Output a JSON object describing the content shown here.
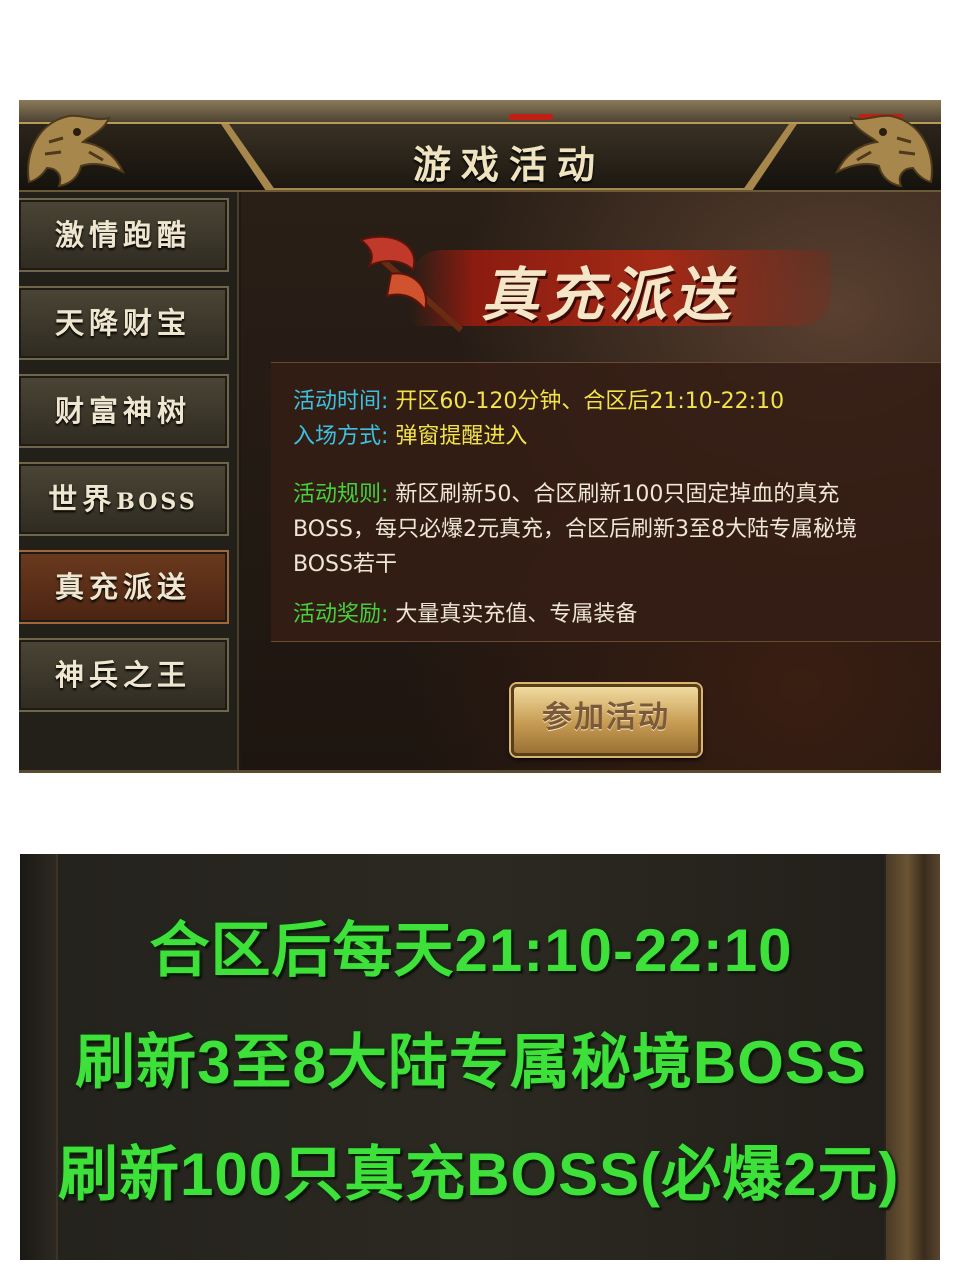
{
  "window": {
    "title": "游戏活动"
  },
  "sidebar": {
    "items": [
      {
        "label": "激情跑酷",
        "active": false
      },
      {
        "label": "天降财宝",
        "active": false
      },
      {
        "label": "财富神树",
        "active": false
      },
      {
        "label": "世界",
        "suffix": "BOSS",
        "active": false
      },
      {
        "label": "真充派送",
        "active": true
      },
      {
        "label": "神兵之王",
        "active": false
      }
    ]
  },
  "event": {
    "banner_title": "真充派送",
    "time_label": "活动时间:",
    "time_value": "开区60-120分钟、合区后21:10-22:10",
    "entry_label": "入场方式:",
    "entry_value": "弹窗提醒进入",
    "rules_label": "活动规则:",
    "rules_line1": "新区刷新50、合区刷新100只固定掉血的真充",
    "rules_line2": "BOSS，每只必爆2元真充，合区后刷新3至8大陆专属秘境",
    "rules_line3": "BOSS若干",
    "reward_label": "活动奖励:",
    "reward_value": "大量真实充值、专属装备",
    "join_button": "参加活动"
  },
  "promo": {
    "lines": [
      "合区后每天21:10-22:10",
      "刷新3至8大陆专属秘境BOSS",
      "刷新100只真充BOSS(必爆2元)"
    ]
  },
  "colors": {
    "label_blue": "#3ec0e0",
    "label_green": "#46d13a",
    "value_yellow": "#f2e34a",
    "promo_green": "#3ee03a",
    "active_menu": "#6b3a1e"
  }
}
